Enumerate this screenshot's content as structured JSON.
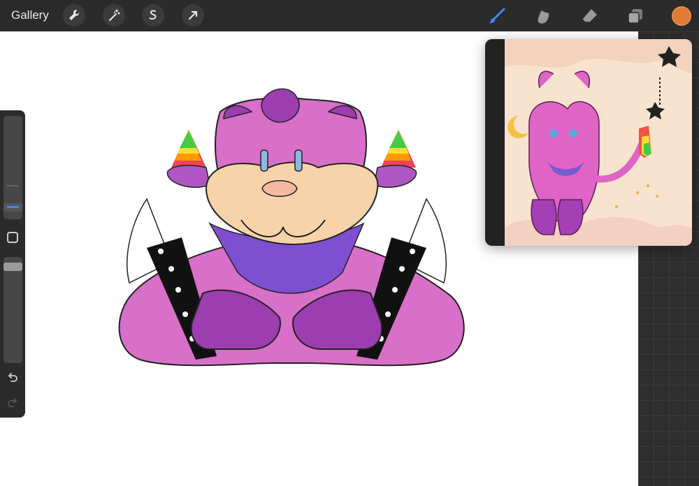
{
  "toolbar": {
    "gallery_label": "Gallery",
    "left_tools": [
      "wrench-icon",
      "magic-wand-icon",
      "selection-icon",
      "transform-arrow-icon"
    ],
    "right_tools": [
      "brush-icon",
      "smudge-icon",
      "eraser-icon",
      "layers-icon"
    ],
    "current_color": "#e07a35",
    "active_tool_color": "#3d8bfd"
  },
  "sidebar": {
    "controls": [
      "brush-size-slider",
      "modify-button",
      "opacity-slider",
      "undo-button",
      "redo-button"
    ]
  },
  "reference": {
    "window": "reference-window"
  }
}
